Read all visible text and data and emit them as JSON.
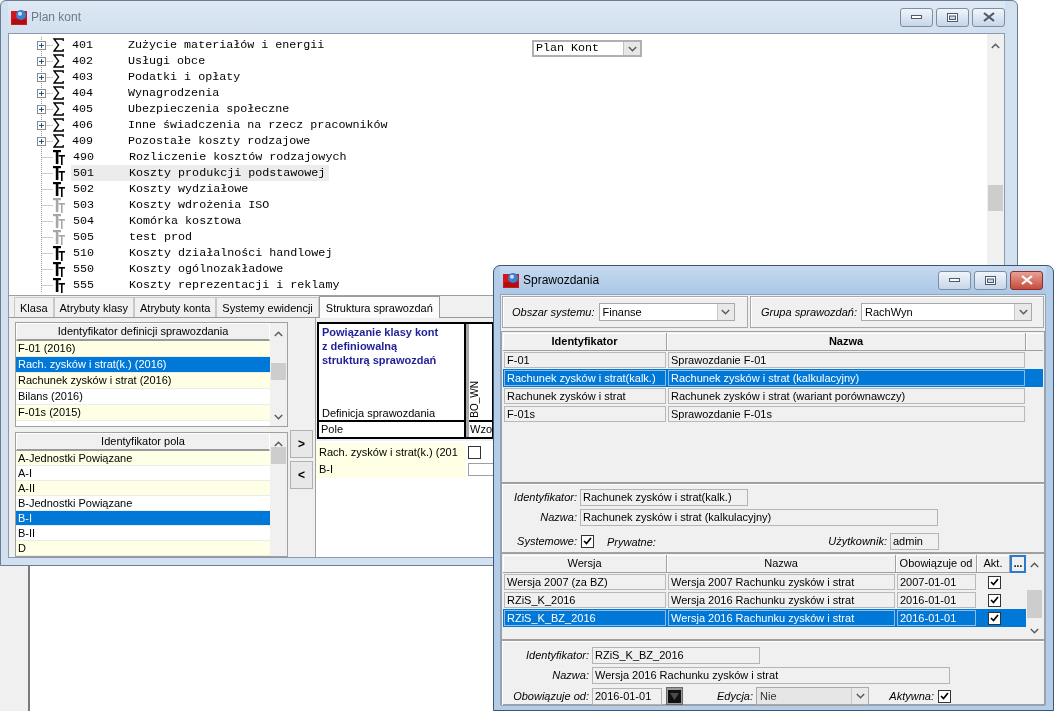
{
  "plan_kont_window": {
    "title": "Plan kont",
    "active": false,
    "view_select": {
      "value": "Plan Kont"
    },
    "tree": [
      {
        "kind": "sum",
        "code": "401",
        "name": "Zużycie materiałów i energii",
        "expanded": false,
        "active": true,
        "selected": false
      },
      {
        "kind": "sum",
        "code": "402",
        "name": "Usługi obce",
        "expanded": false,
        "active": true,
        "selected": false
      },
      {
        "kind": "sum",
        "code": "403",
        "name": "Podatki i opłaty",
        "expanded": false,
        "active": true,
        "selected": false
      },
      {
        "kind": "sum",
        "code": "404",
        "name": "Wynagrodzenia",
        "expanded": false,
        "active": true,
        "selected": false
      },
      {
        "kind": "sum",
        "code": "405",
        "name": "Ubezpieczenia społeczne",
        "expanded": false,
        "active": true,
        "selected": false
      },
      {
        "kind": "sum",
        "code": "406",
        "name": "Inne świadczenia na rzecz pracowników",
        "expanded": false,
        "active": true,
        "selected": false
      },
      {
        "kind": "sum",
        "code": "409",
        "name": "Pozostałe koszty rodzajowe",
        "expanded": false,
        "active": true,
        "selected": false
      },
      {
        "kind": "account",
        "code": "490",
        "name": "Rozliczenie kosztów rodzajowych",
        "active": true,
        "selected": false
      },
      {
        "kind": "account",
        "code": "501",
        "name": "Koszty produkcji podstawowej",
        "active": true,
        "selected": true
      },
      {
        "kind": "account",
        "code": "502",
        "name": "Koszty wydziałowe",
        "active": true,
        "selected": false
      },
      {
        "kind": "account",
        "code": "503",
        "name": "Koszty wdrożenia ISO",
        "active": false,
        "selected": false
      },
      {
        "kind": "account",
        "code": "504",
        "name": "Komórka kosztowa",
        "active": false,
        "selected": false
      },
      {
        "kind": "account",
        "code": "505",
        "name": "test prod",
        "active": false,
        "selected": false
      },
      {
        "kind": "account",
        "code": "510",
        "name": "Koszty działalności handlowej",
        "active": true,
        "selected": false
      },
      {
        "kind": "account",
        "code": "550",
        "name": "Koszty ogólnozakładowe",
        "active": true,
        "selected": false
      },
      {
        "kind": "account",
        "code": "555",
        "name": "Koszty reprezentacji i reklamy",
        "active": true,
        "selected": false
      }
    ],
    "tabs": [
      {
        "label": "Klasa",
        "selected": false
      },
      {
        "label": "Atrybuty klasy",
        "selected": false
      },
      {
        "label": "Atrybuty konta",
        "selected": false
      },
      {
        "label": "Systemy ewidencji",
        "selected": false
      },
      {
        "label": "Struktura sprawozdań",
        "selected": true
      }
    ],
    "report_definitions": {
      "header": "Identyfikator definicji sprawozdania",
      "items": [
        {
          "label": "F-01 (2016)",
          "selected": false
        },
        {
          "label": "Rach. zysków i strat(k.) (2016)",
          "selected": true
        },
        {
          "label": "Rachunek zysków i strat (2016)",
          "selected": false
        },
        {
          "label": "Bilans (2016)",
          "selected": false
        },
        {
          "label": "F-01s (2015)",
          "selected": false
        }
      ]
    },
    "report_fields": {
      "header": "Identyfikator pola",
      "items": [
        {
          "label": "A-Jednostki Powiązane",
          "selected": false
        },
        {
          "label": "A-I",
          "selected": false
        },
        {
          "label": "A-II",
          "selected": false
        },
        {
          "label": "B-Jednostki Powiązane",
          "selected": false
        },
        {
          "label": "B-I",
          "selected": true
        },
        {
          "label": "B-II",
          "selected": false
        },
        {
          "label": "D",
          "selected": false
        }
      ]
    },
    "move_buttons": [
      ">",
      "<"
    ],
    "binding_grid": {
      "title": "Powiązanie klasy kont z definiowalną strukturą sprawozdań",
      "definition_label": "Definicja sprawozdania",
      "field_label": "Pole",
      "column": {
        "header": "BO_WN",
        "subheader": "Wzo"
      },
      "rows": [
        {
          "label": "Rach. zysków i strat(k.) (201",
          "kind": "checkbox",
          "checked": false
        },
        {
          "label": "B-I",
          "kind": "input"
        }
      ]
    }
  },
  "sprawozdania_window": {
    "title": "Sprawozdania",
    "active": true,
    "filters": [
      {
        "label": "Obszar systemu:",
        "value": "Finanse"
      },
      {
        "label": "Grupa sprawozdań:",
        "value": "RachWyn"
      }
    ],
    "reports": {
      "columns": [
        "Identyfikator",
        "Nazwa"
      ],
      "rows": [
        {
          "cells": [
            "F-01",
            "Sprawozdanie F-01"
          ],
          "selected": false
        },
        {
          "cells": [
            "Rachunek zysków i strat(kalk.)",
            "Rachunek zysków i strat (kalkulacyjny)"
          ],
          "selected": true
        },
        {
          "cells": [
            "Rachunek zysków i strat",
            "Rachunek zysków i strat (wariant porównawczy)"
          ],
          "selected": false
        },
        {
          "cells": [
            "F-01s",
            "Sprawozdanie F-01s"
          ],
          "selected": false
        }
      ]
    },
    "report_details": {
      "identifier": {
        "label": "Identyfikator:",
        "value": "Rachunek zysków i strat(kalk.)"
      },
      "name": {
        "label": "Nazwa:",
        "value": "Rachunek zysków i strat (kalkulacyjny)"
      },
      "system": {
        "label": "Systemowe:",
        "checked": true
      },
      "private": {
        "label": "Prywatne:"
      },
      "user": {
        "label": "Użytkownik:",
        "value": "admin"
      }
    },
    "versions": {
      "columns": [
        "Wersja",
        "Nazwa",
        "Obowiązuje od",
        "Akt."
      ],
      "more_button": "...",
      "rows": [
        {
          "cells": [
            "Wersja 2007 (za BZ)",
            "Wersja 2007 Rachunku zysków i strat",
            "2007-01-01"
          ],
          "active": true,
          "selected": false
        },
        {
          "cells": [
            "RZiS_K_2016",
            "Wersja 2016 Rachunku zysków i strat",
            "2016-01-01"
          ],
          "active": true,
          "selected": false
        },
        {
          "cells": [
            "RZiS_K_BZ_2016",
            "Wersja 2016 Rachunku zysków i strat",
            "2016-01-01"
          ],
          "active": true,
          "selected": true
        }
      ]
    },
    "version_details": {
      "identifier": {
        "label": "Identyfikator:",
        "value": "RZiS_K_BZ_2016"
      },
      "name": {
        "label": "Nazwa:",
        "value": "Wersja 2016 Rachunku zysków i strat"
      },
      "valid_from": {
        "label": "Obowiązuje od:",
        "value": "2016-01-01"
      },
      "edit": {
        "label": "Edycja:",
        "value": "Nie",
        "disabled": true
      },
      "active": {
        "label": "Aktywna:",
        "checked": true
      }
    }
  }
}
